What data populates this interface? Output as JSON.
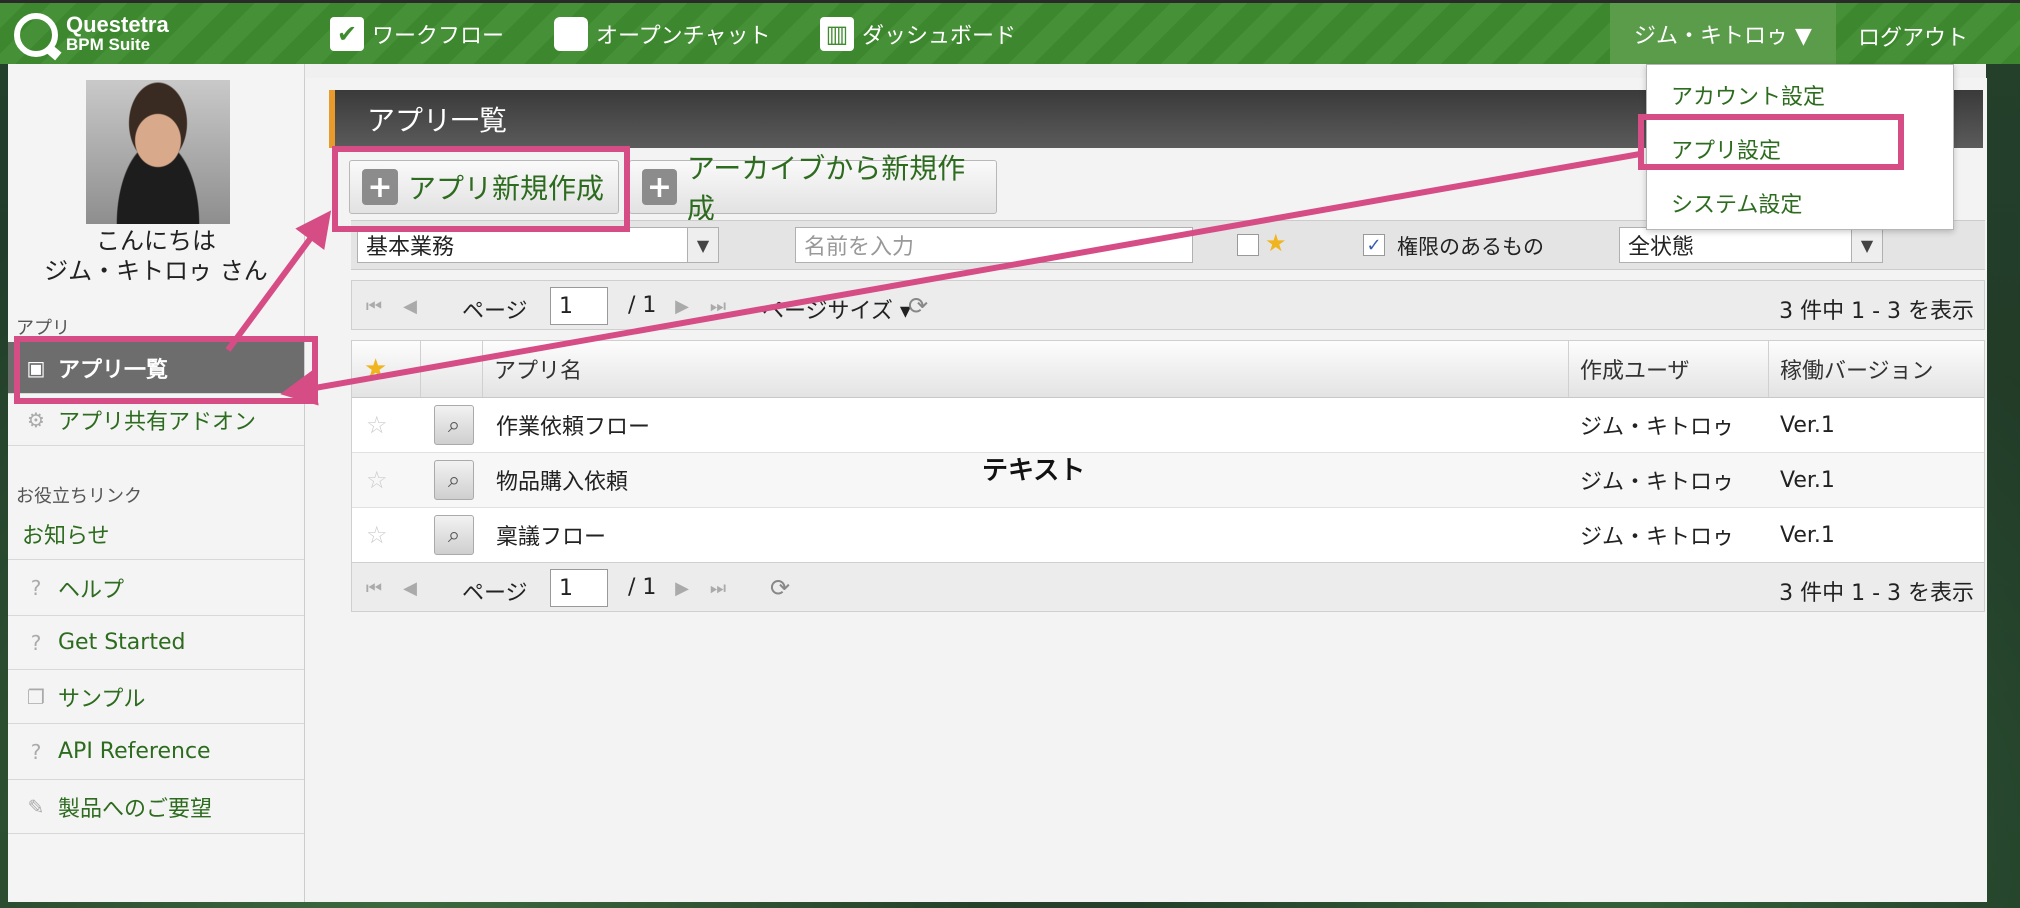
{
  "app": {
    "logo_title": "Questetra",
    "logo_sub": "BPM Suite"
  },
  "topnav": {
    "workflow": "ワークフロー",
    "openchat": "オープンチャット",
    "dashboard": "ダッシュボード",
    "user_menu": "ジム・キトロゥ ▼",
    "logout": "ログアウト"
  },
  "user_dropdown": {
    "items": [
      "アカウント設定",
      "アプリ設定",
      "システム設定"
    ]
  },
  "sidebar": {
    "greeting_line1": "こんにちは",
    "greeting_line2": "ジム・キトロゥ さん",
    "section_app": "アプリ",
    "app_items": [
      "アプリ一覧",
      "アプリ共有アドオン"
    ],
    "section_links": "お役立ちリンク",
    "link_items": [
      "お知らせ",
      "ヘルプ",
      "Get Started",
      "サンプル",
      "API Reference",
      "製品へのご要望"
    ]
  },
  "main": {
    "title": "アプリ一覧",
    "new_app_button": "アプリ新規作成",
    "archive_new_button": "アーカイブから新規作成",
    "filter": {
      "category": "基本業務",
      "name_placeholder": "名前を入力",
      "permission_label": "権限のあるもの",
      "state": "全状態"
    },
    "pager": {
      "page_label": "ページ",
      "page_value": "1",
      "total_pages": "/ 1",
      "page_size": "ページサイズ",
      "summary": "3 件中 1 - 3 を表示"
    },
    "table": {
      "headers": [
        "アプリ名",
        "作成ユーザ",
        "稼働バージョン"
      ],
      "rows": [
        {
          "name": "作業依頼フロー",
          "user": "ジム・キトロゥ",
          "version": "Ver.1"
        },
        {
          "name": "物品購入依頼",
          "user": "ジム・キトロゥ",
          "version": "Ver.1"
        },
        {
          "name": "稟議フロー",
          "user": "ジム・キトロゥ",
          "version": "Ver.1"
        }
      ]
    }
  },
  "annotation": {
    "text_label": "テキスト",
    "highlight_color": "#d64d86"
  },
  "colors": {
    "topbar": "#3f8c2f",
    "link_green": "#2d6b1f",
    "active_item": "#6d6d6d"
  }
}
